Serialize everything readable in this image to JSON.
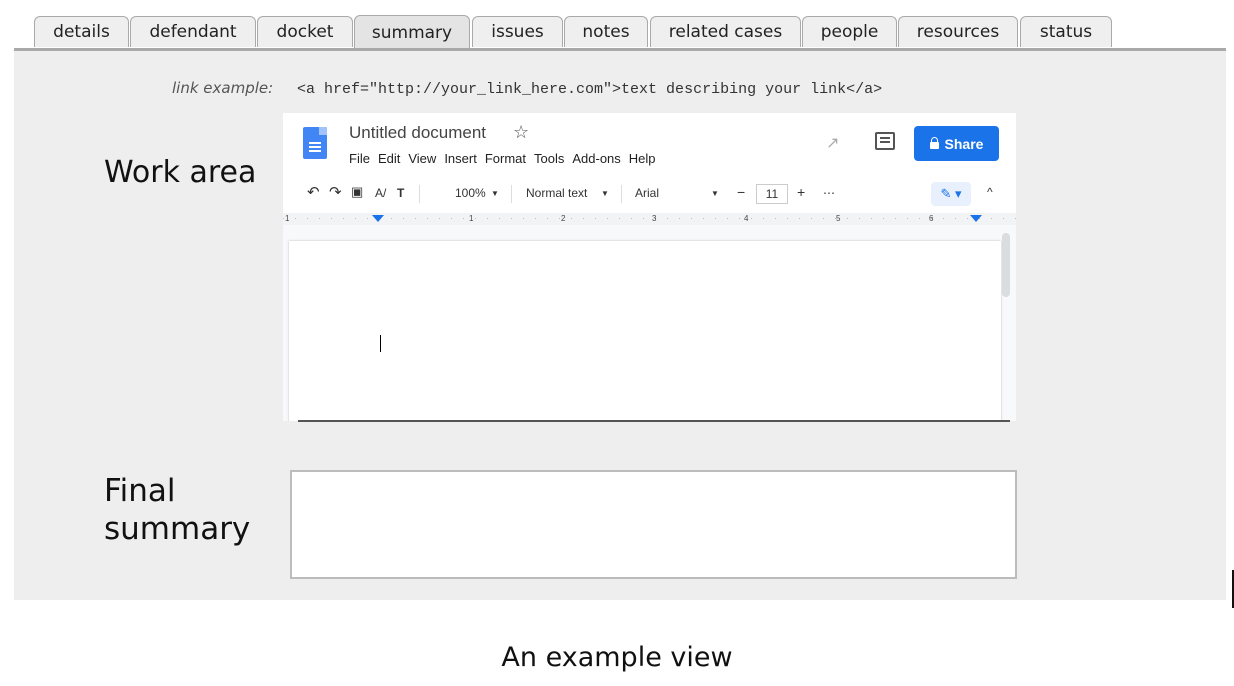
{
  "tabs": [
    {
      "label": "details",
      "active": false
    },
    {
      "label": "defendant",
      "active": false
    },
    {
      "label": "docket",
      "active": false
    },
    {
      "label": "summary",
      "active": true
    },
    {
      "label": "issues",
      "active": false
    },
    {
      "label": "notes",
      "active": false
    },
    {
      "label": "related cases",
      "active": false
    },
    {
      "label": "people",
      "active": false
    },
    {
      "label": "resources",
      "active": false
    },
    {
      "label": "status",
      "active": false
    }
  ],
  "link_example": {
    "label": "link example:",
    "code": "<a href=\"http://your_link_here.com\">text describing your link</a>"
  },
  "work_area_label": "Work area",
  "final_summary_label": [
    "Final",
    "summary"
  ],
  "caption": "An example view",
  "gdoc": {
    "title": "Untitled document",
    "menu": [
      "File",
      "Edit",
      "View",
      "Insert",
      "Format",
      "Tools",
      "Add-ons",
      "Help"
    ],
    "share_label": "Share",
    "zoom": "100%",
    "style": "Normal text",
    "font": "Arial",
    "font_size": "11",
    "ruler_marks": [
      "1",
      "1",
      "2",
      "3",
      "4",
      "5",
      "6"
    ],
    "icons": {
      "star": "star-icon",
      "trend": "trend-icon",
      "comment": "comment-icon",
      "lock": "lock-icon",
      "undo": "undo-icon",
      "redo": "redo-icon",
      "print": "print-icon",
      "spellcheck": "spellcheck-icon",
      "paint_format": "paint-format-icon",
      "more": "more-icon",
      "pen": "pen-icon",
      "collapse": "chevron-up-icon"
    }
  },
  "colors": {
    "panel_bg": "#eeeeee",
    "tab_border": "#a9a9a9",
    "share_blue": "#1a73e8"
  }
}
